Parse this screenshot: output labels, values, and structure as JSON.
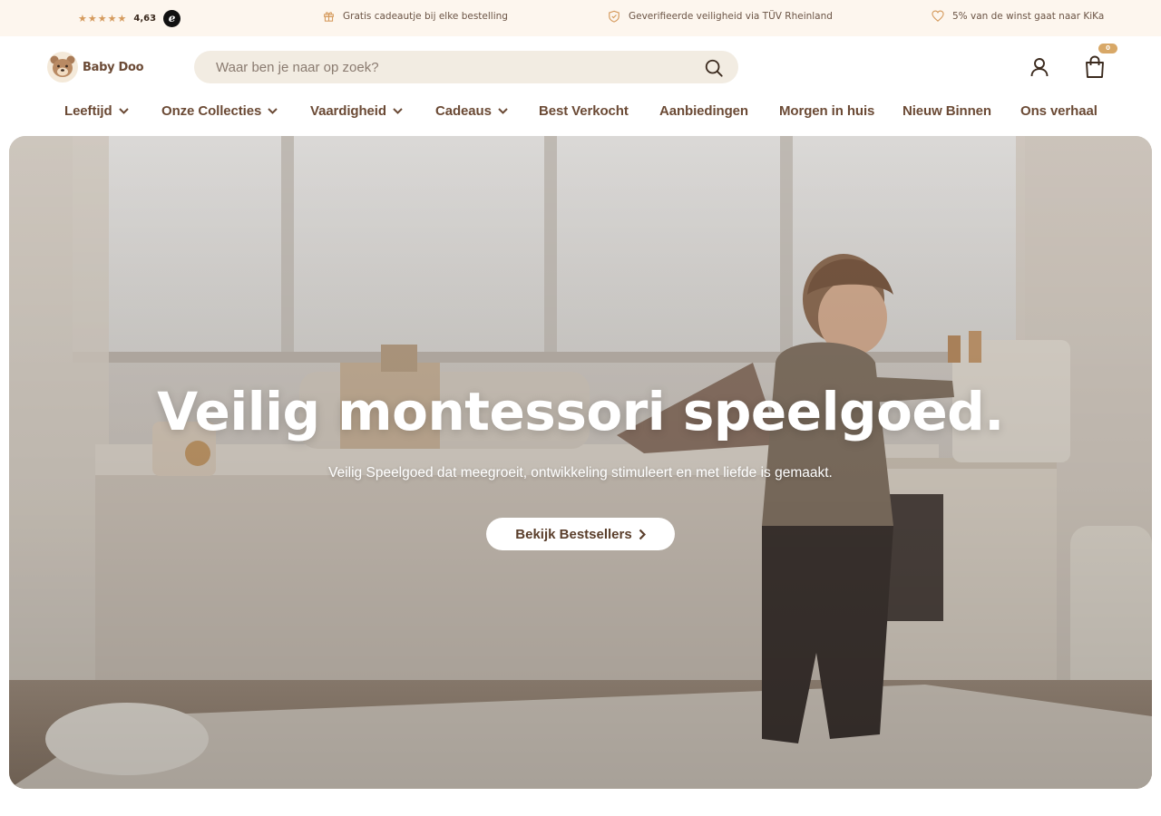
{
  "topbar": {
    "rating": {
      "stars": 5,
      "value": "4,63",
      "badge_letter": "e"
    },
    "usps": [
      {
        "icon": "gift-icon",
        "text": "Gratis cadeautje bij elke bestelling"
      },
      {
        "icon": "shield-check-icon",
        "text": "Geverifieerde veiligheid via TÜV Rheinland"
      },
      {
        "icon": "heart-icon",
        "text": "5% van de winst gaat naar KiKa"
      }
    ]
  },
  "header": {
    "logo_text": "Baby Doo",
    "search": {
      "placeholder": "Waar ben je naar op zoek?"
    },
    "cart_count": "0"
  },
  "nav": {
    "items": [
      {
        "label": "Leeftijd",
        "dropdown": true
      },
      {
        "label": "Onze Collecties",
        "dropdown": true
      },
      {
        "label": "Vaardigheid",
        "dropdown": true
      },
      {
        "label": "Cadeaus",
        "dropdown": true
      },
      {
        "label": "Best Verkocht",
        "dropdown": false
      },
      {
        "label": "Aanbiedingen",
        "dropdown": false
      },
      {
        "label": "Morgen in huis",
        "dropdown": false
      },
      {
        "label": "Nieuw Binnen",
        "dropdown": false
      },
      {
        "label": "Ons verhaal",
        "dropdown": false
      }
    ]
  },
  "hero": {
    "title": "Veilig montessori speelgoed.",
    "subtitle": "Veilig Speelgoed dat meegroeit, ontwikkeling stimuleert en met liefde is gemaakt.",
    "cta_label": "Bekijk Bestsellers"
  },
  "colors": {
    "brand_brown": "#6b4a35",
    "topbar_bg": "#fdf6ee",
    "search_bg": "#f2ece2",
    "star": "#d59a5c",
    "cart_badge": "#d8a867"
  }
}
